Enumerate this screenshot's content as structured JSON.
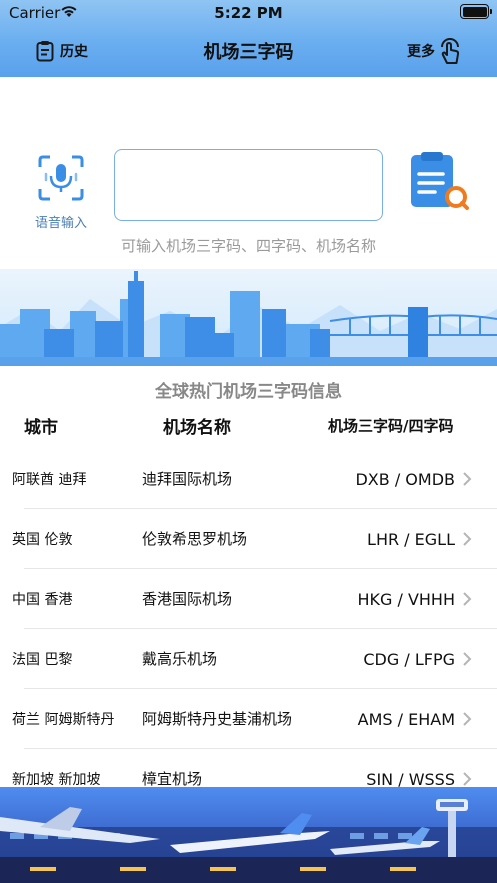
{
  "status_bar": {
    "carrier": "Carrier",
    "time": "5:22 PM"
  },
  "nav": {
    "history_label": "历史",
    "title": "机场三字码",
    "more_label": "更多"
  },
  "search": {
    "voice_label": "语音输入",
    "input_value": "",
    "hint": "可输入机场三字码、四字码、机场名称"
  },
  "section": {
    "title": "全球热门机场三字码信息",
    "headers": {
      "city": "城市",
      "name": "机场名称",
      "code": "机场三字码/四字码"
    }
  },
  "airports": [
    {
      "city": "阿联酋 迪拜",
      "name": "迪拜国际机场",
      "code": "DXB / OMDB"
    },
    {
      "city": "英国 伦敦",
      "name": "伦敦希思罗机场",
      "code": "LHR / EGLL"
    },
    {
      "city": "中国 香港",
      "name": "香港国际机场",
      "code": "HKG / VHHH"
    },
    {
      "city": "法国 巴黎",
      "name": "戴高乐机场",
      "code": "CDG / LFPG"
    },
    {
      "city": "荷兰 阿姆斯特丹",
      "name": "阿姆斯特丹史基浦机场",
      "code": "AMS / EHAM"
    },
    {
      "city": "新加坡 新加坡",
      "name": "樟宜机场",
      "code": "SIN / WSSS"
    }
  ],
  "icons": {
    "history": "clipboard-icon",
    "more": "tap-hand-icon",
    "voice": "microphone-icon",
    "scan": "document-search-icon",
    "row": "chevron-right-icon"
  },
  "colors": {
    "header_top": "#8fc4f3",
    "header_bottom": "#5aa1ec",
    "accent": "#3a8ee6",
    "input_border": "#7aaee8",
    "hint": "#9a9a9a"
  }
}
